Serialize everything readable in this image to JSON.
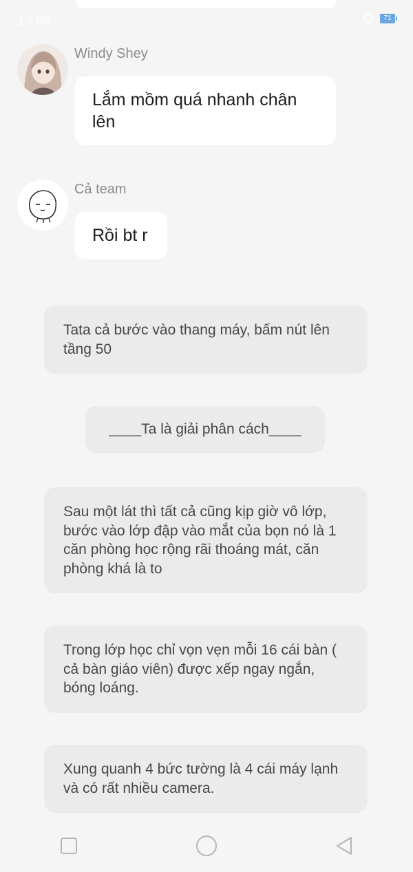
{
  "status_bar": {
    "time": "13:05",
    "battery": "71"
  },
  "messages": [
    {
      "sender": "Windy Shey",
      "text": "Lắm mồm quá nhanh chân lên",
      "avatar_icon": "anime-girl-avatar"
    },
    {
      "sender": "Cả team",
      "text": "Rồi bt r",
      "avatar_icon": "cute-blob-avatar"
    }
  ],
  "narrations": [
    "Tata cả bước vào thang máy, bấm nút lên tầng 50",
    "Sau một lát thì tất cả cũng kịp giờ vô lớp, bước vào lớp đập vào mắt của bọn nó là 1 căn phòng học rộng rãi thoáng mát, căn phòng khá là to",
    "Trong lớp học chỉ vọn vẹn mỗi 16 cái bàn ( cả bàn giáo viên) được xếp ngay ngắn, bóng loáng.",
    "Xung quanh 4 bức tường là 4 cái máy lạnh và có rất nhiều camera."
  ],
  "divider_text": "____Ta là giải phân cách____",
  "nav_bar": {
    "buttons": [
      "recent-apps-icon",
      "home-icon",
      "back-icon"
    ]
  }
}
